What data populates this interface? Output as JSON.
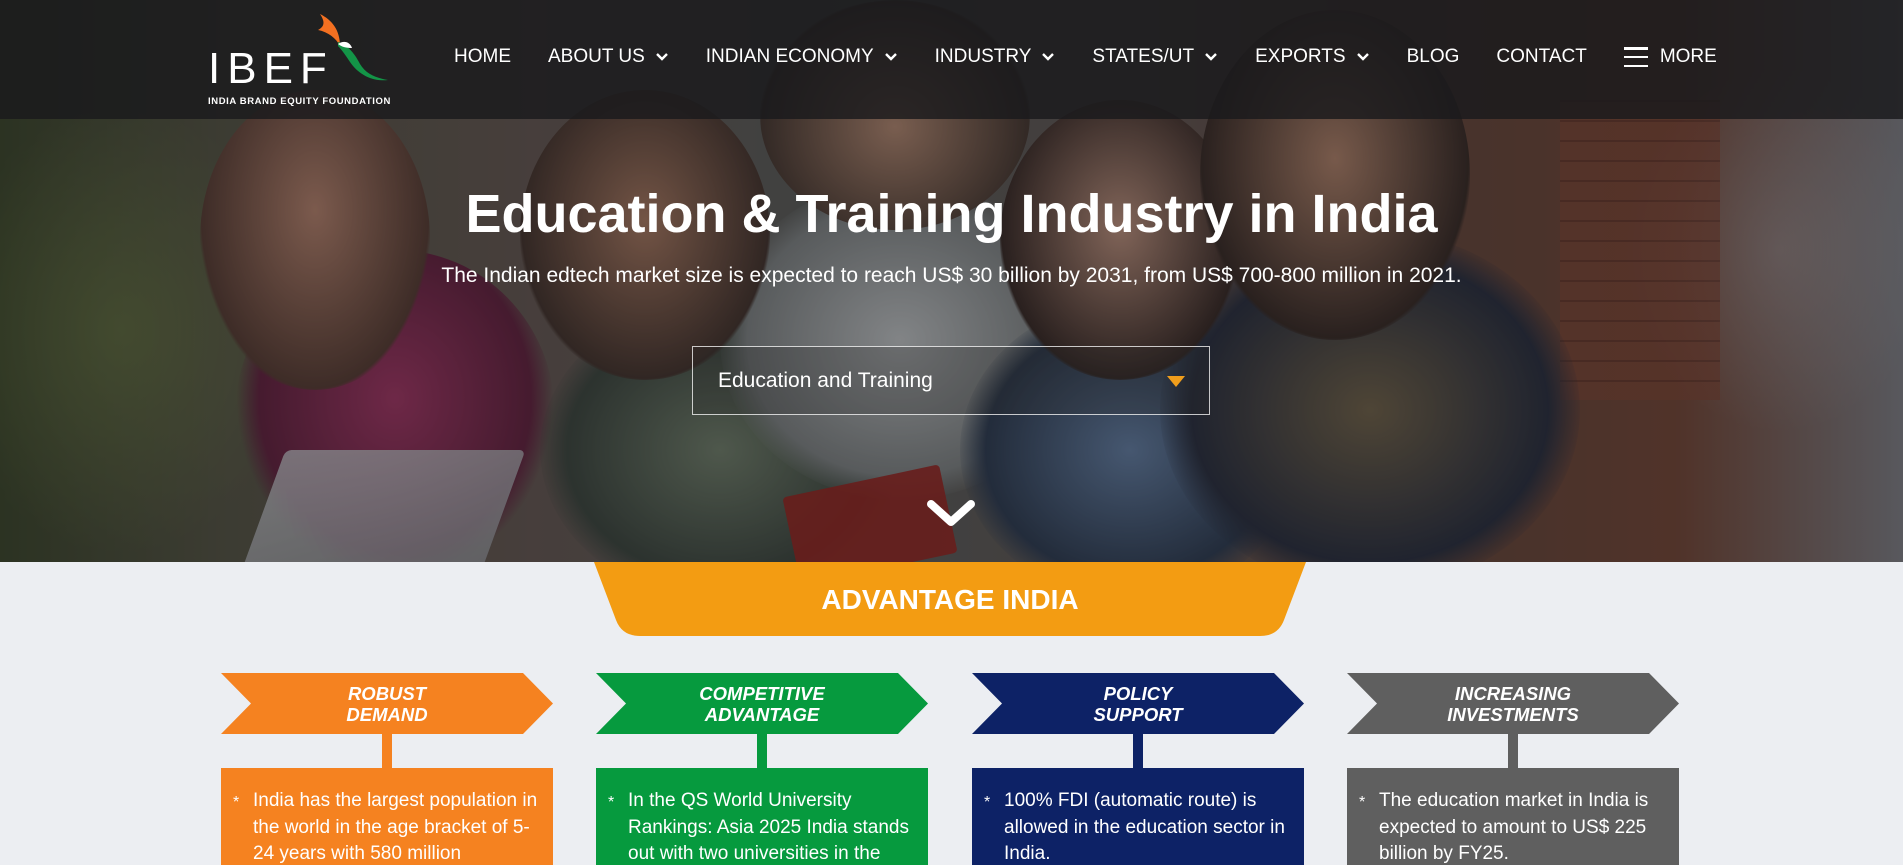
{
  "brand": {
    "name": "IBEF",
    "tagline": "INDIA BRAND EQUITY FOUNDATION"
  },
  "nav": {
    "items": [
      {
        "label": "HOME",
        "has_dropdown": false
      },
      {
        "label": "ABOUT US",
        "has_dropdown": true
      },
      {
        "label": "INDIAN ECONOMY",
        "has_dropdown": true
      },
      {
        "label": "INDUSTRY",
        "has_dropdown": true
      },
      {
        "label": "STATES/UT",
        "has_dropdown": true
      },
      {
        "label": "EXPORTS",
        "has_dropdown": true
      },
      {
        "label": "BLOG",
        "has_dropdown": false
      },
      {
        "label": "CONTACT",
        "has_dropdown": false
      }
    ],
    "more_label": "MORE"
  },
  "hero": {
    "title": "Education & Training Industry in India",
    "subtitle": "The Indian edtech market size is expected to reach US$ 30 billion by 2031, from US$ 700-800 million in 2021.",
    "select_value": "Education and Training"
  },
  "advantage": {
    "heading": "ADVANTAGE INDIA",
    "cards": [
      {
        "title_line1": "ROBUST",
        "title_line2": "DEMAND",
        "bullet": "*",
        "text": "India has the largest population in the world in the age bracket of 5-24 years with 580 million",
        "color": "#f58220"
      },
      {
        "title_line1": "COMPETITIVE",
        "title_line2": "ADVANTAGE",
        "bullet": "*",
        "text": "In the QS World University Rankings: Asia 2025 India stands out with two universities in the",
        "color": "#069a3e"
      },
      {
        "title_line1": "POLICY",
        "title_line2": "SUPPORT",
        "bullet": "*",
        "text": "100% FDI (automatic route) is allowed in the education sector in India.",
        "color": "#0d2266"
      },
      {
        "title_line1": "INCREASING",
        "title_line2": "INVESTMENTS",
        "bullet": "*",
        "text": "The education market in India is expected to amount to US$ 225 billion by FY25.",
        "color": "#5f5f5f"
      }
    ]
  },
  "colors": {
    "accent_orange": "#f39c12",
    "select_arrow": "#f09e1c"
  }
}
